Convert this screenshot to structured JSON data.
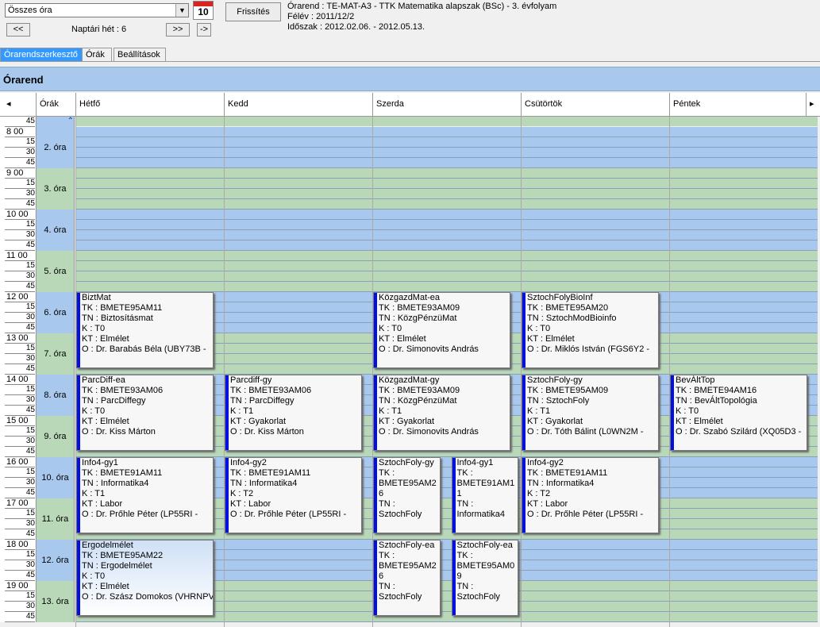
{
  "toolbar": {
    "combo_value": "Összes óra",
    "calendar_day": "10",
    "refresh_label": "Frissítés",
    "prev_label": "<<",
    "next_label": ">>",
    "last_label": "->",
    "week_label": "Naptári hét : 6"
  },
  "info": {
    "line1": "Órarend : TE-MAT-A3 - TTK Matematika alapszak (BSc) - 3. évfolyam",
    "line2": "Félév : 2011/12/2",
    "line3": "Időszak : 2012.02.06. - 2012.05.13."
  },
  "tabs": [
    "Órarendszerkesztő",
    "Órák",
    "Beállítások"
  ],
  "panel_title": "Órarend",
  "columns": {
    "orak": "Órák",
    "days": [
      "Hétfő",
      "Kedd",
      "Szerda",
      "Csütörtök",
      "Péntek"
    ]
  },
  "hours": [
    "8",
    "9",
    "10",
    "11",
    "12",
    "13",
    "14",
    "15",
    "16",
    "17",
    "18",
    "19"
  ],
  "quarters": [
    "15",
    "30",
    "45"
  ],
  "first_label": "45",
  "ora_labels": [
    "2. óra",
    "3. óra",
    "4. óra",
    "5. óra",
    "6. óra",
    "7. óra",
    "8. óra",
    "9. óra",
    "10. óra",
    "11. óra",
    "12. óra",
    "13. óra"
  ],
  "cards": [
    {
      "day": 0,
      "sub": 0,
      "subs": 1,
      "start": 5,
      "len": 2,
      "lines": [
        "BiztMat",
        "TK : BMETE95AM11",
        "TN : Biztosításmat",
        "K : T0",
        "KT : Elmélet",
        "O :  Dr. Barabás Béla (UBY73B -"
      ]
    },
    {
      "day": 2,
      "sub": 0,
      "subs": 1,
      "start": 5,
      "len": 2,
      "lines": [
        "KözgazdMat-ea",
        "TK : BMETE93AM09",
        "TN : KözgPénzüMat",
        "K : T0",
        "KT : Elmélet",
        "O :  Dr. Simonovits András"
      ]
    },
    {
      "day": 3,
      "sub": 0,
      "subs": 1,
      "start": 5,
      "len": 2,
      "lines": [
        "SztochFolyBioInf",
        "TK : BMETE95AM20",
        "TN : SztochModBioinfo",
        "K : T0",
        "KT : Elmélet",
        "O :  Dr. Miklós István (FGS6Y2 -"
      ]
    },
    {
      "day": 0,
      "sub": 0,
      "subs": 1,
      "start": 7,
      "len": 2,
      "lines": [
        "ParcDiff-ea",
        "TK : BMETE93AM06",
        "TN : ParcDiffegy",
        "K : T0",
        "KT : Elmélet",
        "O :  Dr. Kiss Márton"
      ]
    },
    {
      "day": 1,
      "sub": 0,
      "subs": 1,
      "start": 7,
      "len": 2,
      "lines": [
        "Parcdiff-gy",
        "TK : BMETE93AM06",
        "TN : ParcDiffegy",
        "K : T1",
        "KT : Gyakorlat",
        "O :  Dr. Kiss Márton"
      ]
    },
    {
      "day": 2,
      "sub": 0,
      "subs": 1,
      "start": 7,
      "len": 2,
      "lines": [
        "KözgazdMat-gy",
        "TK : BMETE93AM09",
        "TN : KözgPénzüMat",
        "K : T1",
        "KT : Gyakorlat",
        "O :  Dr. Simonovits András"
      ]
    },
    {
      "day": 3,
      "sub": 0,
      "subs": 1,
      "start": 7,
      "len": 2,
      "lines": [
        "SztochFoly-gy",
        "TK : BMETE95AM09",
        "TN : SztochFoly",
        "K : T1",
        "KT : Gyakorlat",
        "O :  Dr. Tóth Bálint (L0WN2M -"
      ]
    },
    {
      "day": 4,
      "sub": 0,
      "subs": 1,
      "start": 7,
      "len": 2,
      "lines": [
        "BevÁltTop",
        "TK : BMETE94AM16",
        "TN : BevÁltTopológia",
        "K : T0",
        "KT : Elmélet",
        "O :  Dr. Szabó Szilárd (XQ05D3 -"
      ]
    },
    {
      "day": 0,
      "sub": 0,
      "subs": 1,
      "start": 9,
      "len": 2,
      "lines": [
        "Info4-gy1",
        "TK : BMETE91AM11",
        "TN : Informatika4",
        "K : T1",
        "KT : Labor",
        "O :  Dr. Prőhle Péter (LP55RI -"
      ]
    },
    {
      "day": 1,
      "sub": 0,
      "subs": 1,
      "start": 9,
      "len": 2,
      "lines": [
        "Info4-gy2",
        "TK : BMETE91AM11",
        "TN : Informatika4",
        "K : T2",
        "KT : Labor",
        "O :  Dr. Prőhle Péter (LP55RI -"
      ]
    },
    {
      "day": 2,
      "sub": 0,
      "subs": 2,
      "start": 9,
      "len": 2,
      "lines": [
        "SztochFoly-gy",
        "TK :",
        "BMETE95AM2",
        "6",
        "TN :",
        "SztochFoly"
      ]
    },
    {
      "day": 2,
      "sub": 1,
      "subs": 2,
      "start": 9,
      "len": 2,
      "lines": [
        "Info4-gy1",
        "TK :",
        "BMETE91AM1",
        "1",
        "TN :",
        "Informatika4"
      ]
    },
    {
      "day": 3,
      "sub": 0,
      "subs": 1,
      "start": 9,
      "len": 2,
      "lines": [
        "Info4-gy2",
        "TK : BMETE91AM11",
        "TN : Informatika4",
        "K : T2",
        "KT : Labor",
        "O :  Dr. Prőhle Péter (LP55RI -"
      ]
    },
    {
      "day": 0,
      "sub": 0,
      "subs": 1,
      "start": 11,
      "len": 2,
      "sel": true,
      "lines": [
        "Ergodelmélet",
        "TK : BMETE95AM22",
        "TN : Ergodelmélet",
        "K : T0",
        "KT : Elmélet",
        "O :  Dr. Szász Domokos (VHRNPV"
      ]
    },
    {
      "day": 2,
      "sub": 0,
      "subs": 2,
      "start": 11,
      "len": 2,
      "lines": [
        "SztochFoly-ea",
        "TK :",
        "BMETE95AM2",
        "6",
        "TN :",
        "SztochFoly"
      ]
    },
    {
      "day": 2,
      "sub": 1,
      "subs": 2,
      "start": 11,
      "len": 2,
      "lines": [
        "SztochFoly-ea",
        "TK :",
        "BMETE95AM0",
        "9",
        "TN :",
        "SztochFoly"
      ]
    }
  ],
  "colors": {
    "blue_band": "#a8c8ee",
    "green_band": "#b8d8b8",
    "card_bar": "#0010e0",
    "tab_active": "#3399ff"
  }
}
